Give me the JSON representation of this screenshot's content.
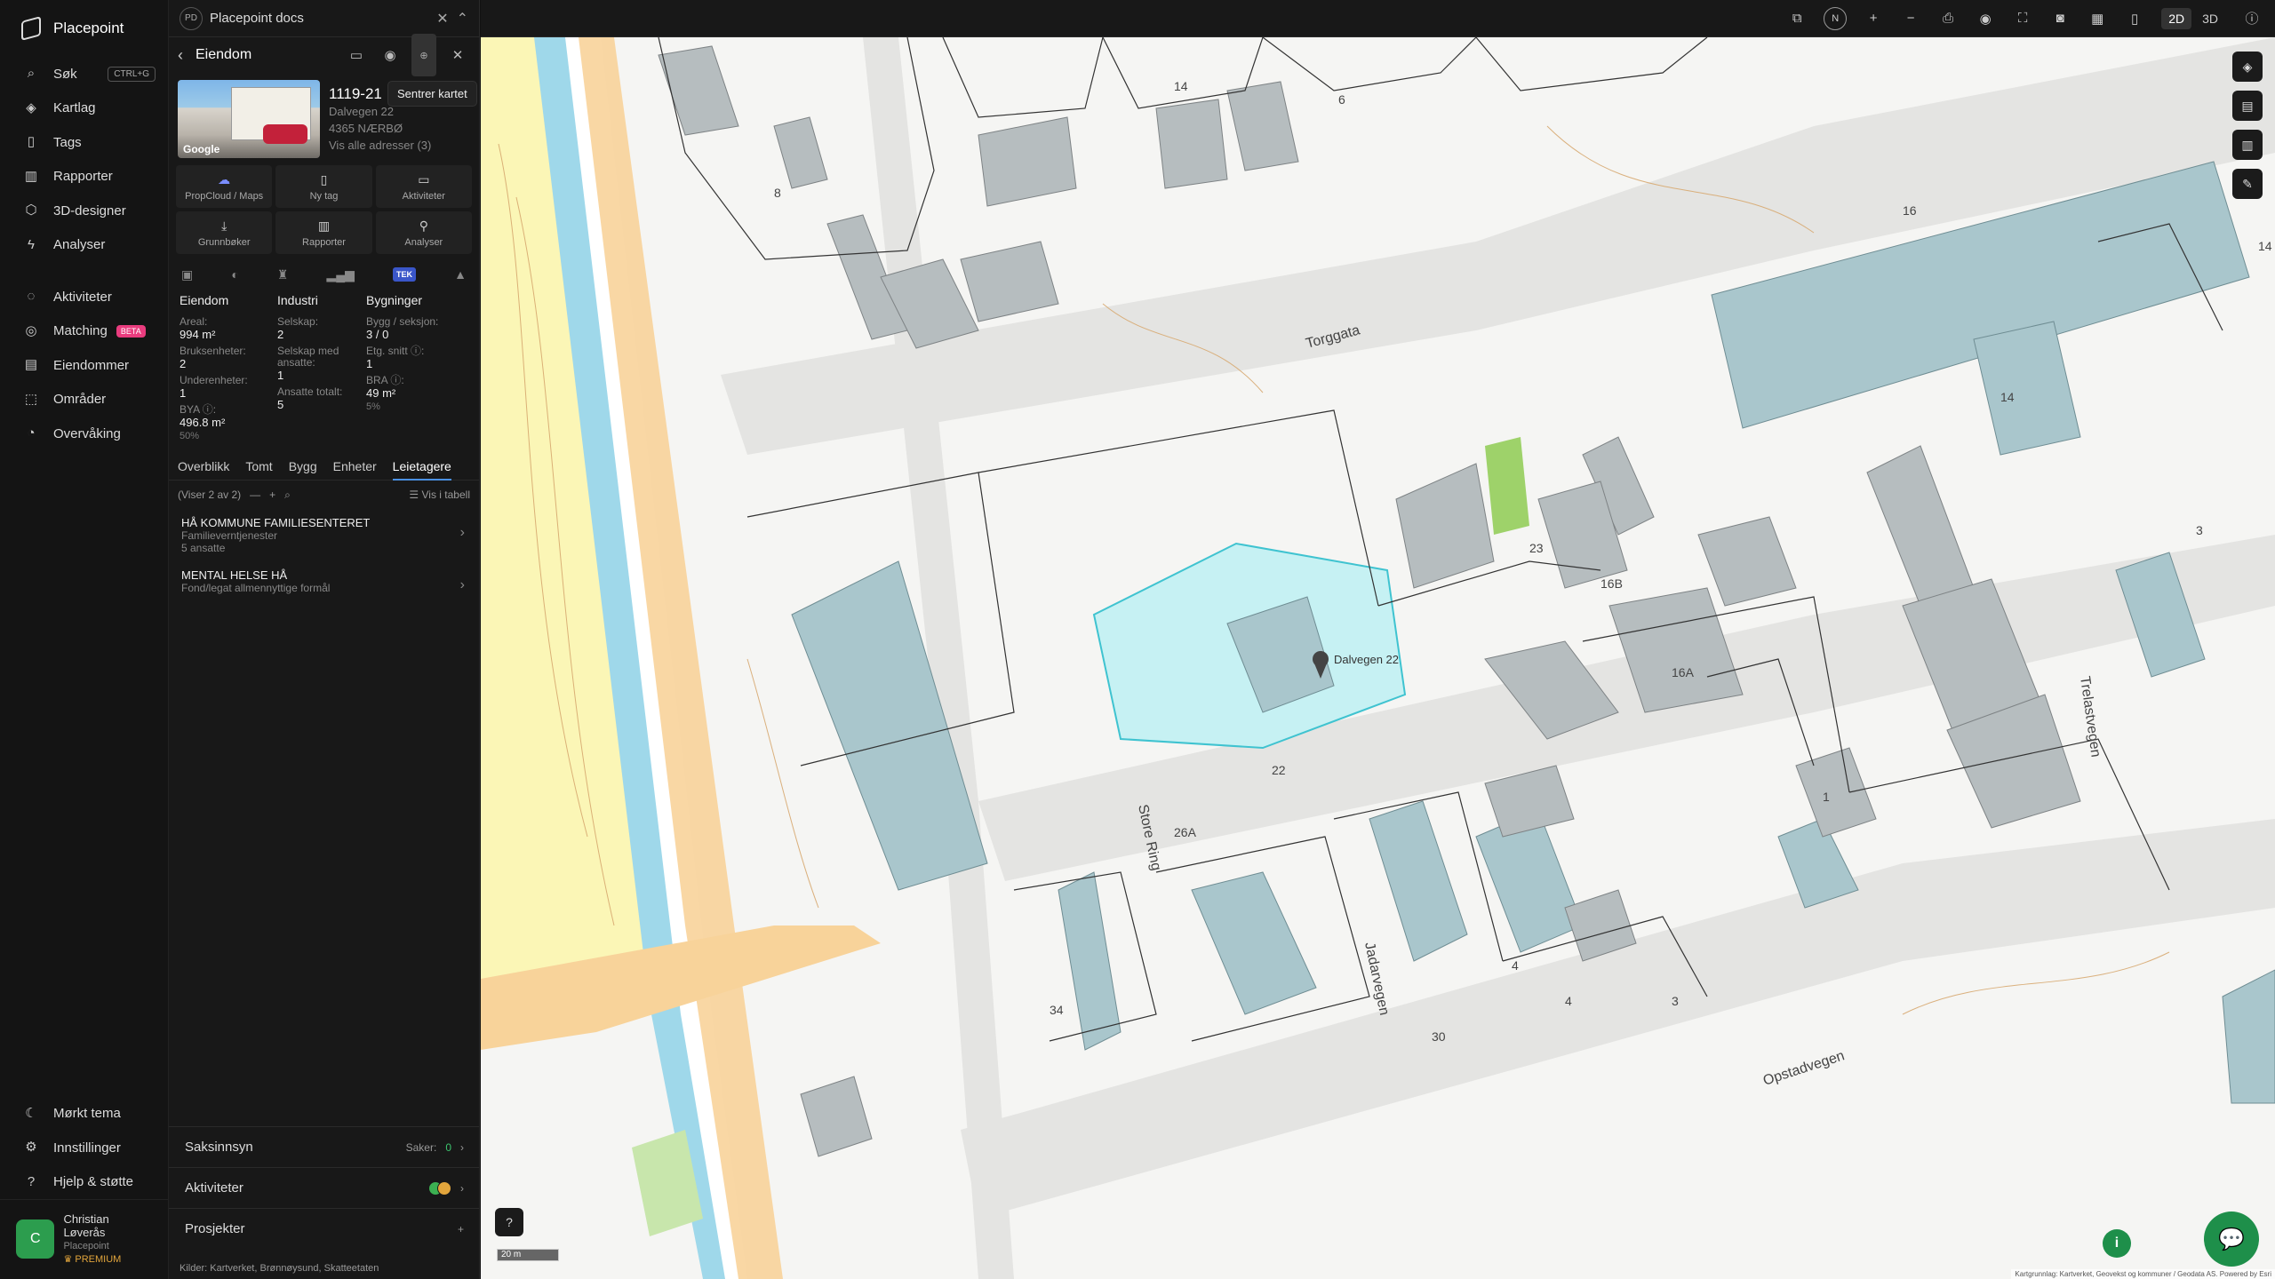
{
  "app": {
    "name": "Placepoint"
  },
  "nav": {
    "items": [
      {
        "label": "Søk",
        "icon": "search-icon",
        "kbd": "CTRL+G"
      },
      {
        "label": "Kartlag",
        "icon": "layers-icon"
      },
      {
        "label": "Tags",
        "icon": "bookmark-icon"
      },
      {
        "label": "Rapporter",
        "icon": "bar-chart-icon"
      },
      {
        "label": "3D-designer",
        "icon": "cube-icon"
      },
      {
        "label": "Analyser",
        "icon": "lightning-icon"
      },
      {
        "label": "Aktiviteter",
        "icon": "chat-icon"
      },
      {
        "label": "Matching",
        "icon": "target-icon",
        "badge": "BETA"
      },
      {
        "label": "Eiendommer",
        "icon": "list-icon"
      },
      {
        "label": "Områder",
        "icon": "area-icon"
      },
      {
        "label": "Overvåking",
        "icon": "monitor-icon"
      }
    ],
    "bottom": [
      {
        "label": "Mørkt tema",
        "icon": "moon-icon"
      },
      {
        "label": "Innstillinger",
        "icon": "gear-icon"
      },
      {
        "label": "Hjelp & støtte",
        "icon": "help-icon"
      }
    ],
    "user": {
      "initial": "C",
      "name": "Christian Løverås",
      "org": "Placepoint",
      "plan": "PREMIUM"
    }
  },
  "panel": {
    "tab_badge": "PD",
    "title": "Placepoint docs",
    "header": "Eiendom",
    "tooltip": "Sentrer kartet",
    "property": {
      "id": "1119-21",
      "address": "Dalvegen 22",
      "postal": "4365 NÆRBØ",
      "all": "Vis alle adresser (3)",
      "photo_label": "Google"
    },
    "actions": [
      {
        "label": "PropCloud / Maps",
        "icon": "cloud-icon"
      },
      {
        "label": "Ny tag",
        "icon": "bookmark-icon"
      },
      {
        "label": "Aktiviteter",
        "icon": "chat-icon"
      },
      {
        "label": "Grunnbøker",
        "icon": "download-icon"
      },
      {
        "label": "Rapporter",
        "icon": "bar-chart-icon"
      },
      {
        "label": "Analyser",
        "icon": "pin-icon"
      }
    ],
    "tek": "TEK",
    "stats": {
      "eiendom": {
        "title": "Eiendom",
        "areal_label": "Areal:",
        "areal": "994 m²",
        "brukse_label": "Bruksenheter:",
        "brukse": "2",
        "under_label": "Underenheter:",
        "under": "1",
        "bya_label": "BYA ⓘ:",
        "bya": "496.8 m²",
        "bya_pct": "50%"
      },
      "industri": {
        "title": "Industri",
        "selskap_label": "Selskap:",
        "selskap": "2",
        "ans_label": "Selskap med ansatte:",
        "ans": "1",
        "tot_label": "Ansatte totalt:",
        "tot": "5"
      },
      "bygninger": {
        "title": "Bygninger",
        "bygg_label": "Bygg / seksjon:",
        "bygg": "3 / 0",
        "etg_label": "Etg. snitt ⓘ:",
        "etg": "1",
        "bra_label": "BRA ⓘ:",
        "bra": "49 m²",
        "bra_pct": "5%"
      }
    },
    "tabs": [
      "Overblikk",
      "Tomt",
      "Bygg",
      "Enheter",
      "Leietagere"
    ],
    "tenant_bar": {
      "count": "(Viser 2 av 2)",
      "table": "Vis i tabell"
    },
    "tenants": [
      {
        "name": "HÅ KOMMUNE FAMILIESENTERET",
        "cat": "Familieverntjenester",
        "emp": "5 ansatte"
      },
      {
        "name": "MENTAL HELSE HÅ",
        "cat": "Fond/legat allmennyttige formål",
        "emp": ""
      }
    ],
    "sections": {
      "saks": "Saksinnsyn",
      "saker_label": "Saker:",
      "saker": "0",
      "akt": "Aktiviteter",
      "prosj": "Prosjekter"
    },
    "sources": "Kilder: Kartverket, Brønnøysund, Skatteetaten"
  },
  "map": {
    "view2d": "2D",
    "view3d": "3D",
    "compass": "N",
    "scale": "20 m",
    "streets": [
      "Torggata",
      "Store Ring",
      "Jadarvegen",
      "Opstadvegen",
      "Trelastvegen"
    ],
    "addr_label": "Dalvegen 22",
    "attribution": "Kartgrunnlag: Kartverket, Geovekst og kommuner / Geodata AS. Powered by Esri"
  }
}
